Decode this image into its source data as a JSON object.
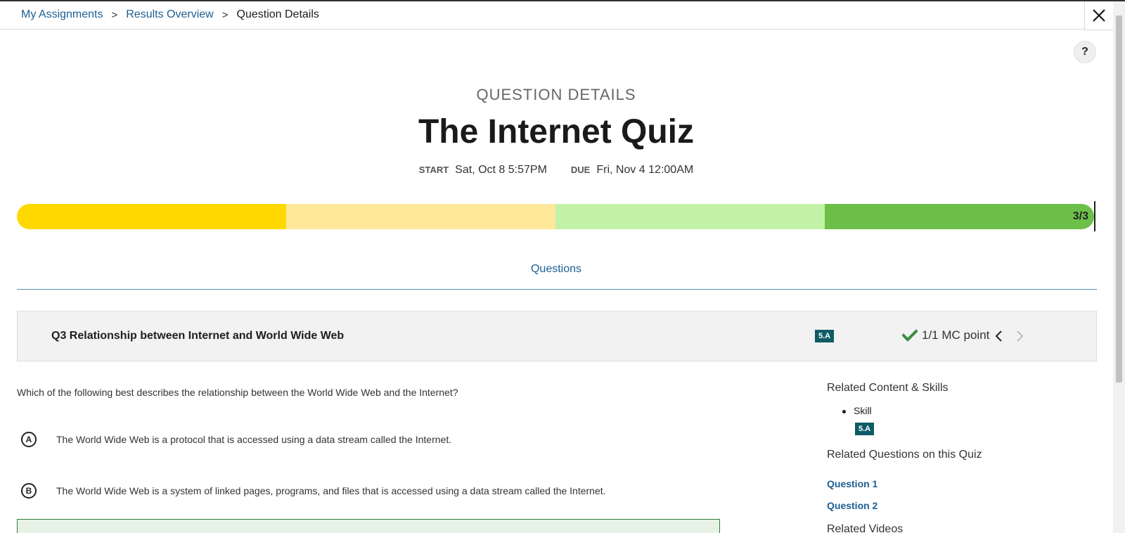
{
  "breadcrumb": {
    "items": [
      "My Assignments",
      "Results Overview"
    ],
    "current": "Question Details",
    "separator": ">"
  },
  "header": {
    "close_icon": "close-icon",
    "help_label": "?"
  },
  "quiz": {
    "eyebrow": "QUESTION DETAILS",
    "title": "The Internet Quiz",
    "start_label": "START",
    "start_value": "Sat, Oct 8 5:57PM",
    "due_label": "DUE",
    "due_value": "Fri, Nov 4 12:00AM"
  },
  "progress": {
    "label": "3/3",
    "segment_colors": [
      "#ffd800",
      "#ffe89a",
      "#c2f2a8",
      "#6cc04a"
    ]
  },
  "tabs": {
    "questions": "Questions"
  },
  "question": {
    "title": "Q3 Relationship between Internet and World Wide Web",
    "skill_badge": "5.A",
    "score": "1/1 MC point",
    "check_color": "#3a8f3f",
    "prompt": "Which of the following best describes the relationship between the World Wide Web and the Internet?",
    "choices": [
      {
        "letter": "A",
        "text": "The World Wide Web is a protocol that is accessed using a data stream called the Internet."
      },
      {
        "letter": "B",
        "text": "The World Wide Web is a system of linked pages, programs, and files that is accessed using a data stream called the Internet."
      }
    ]
  },
  "sidebar": {
    "related_content_heading": "Related Content & Skills",
    "skill_label": "Skill",
    "skill_badge": "5.A",
    "related_questions_heading": "Related Questions on this Quiz",
    "related_questions": [
      "Question 1",
      "Question 2"
    ],
    "related_videos_heading": "Related Videos"
  }
}
